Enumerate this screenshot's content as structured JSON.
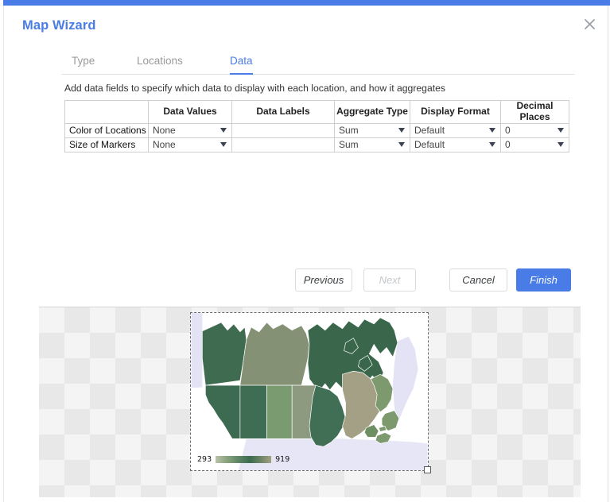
{
  "window": {
    "accent_color": "#4a7ce8",
    "title": "Map Wizard",
    "close_label": "close-icon"
  },
  "tabs": [
    {
      "label": "Type",
      "active": false
    },
    {
      "label": "Locations",
      "active": false
    },
    {
      "label": "Data",
      "active": true
    }
  ],
  "main": {
    "description": "Add data fields to specify which data to display with each location, and how it aggregates",
    "table": {
      "headers": [
        "",
        "Data Values",
        "Data Labels",
        "Aggregate Type",
        "Display Format",
        "Decimal Places"
      ],
      "rows": [
        {
          "label": "Color of Locations",
          "data_values": "None",
          "data_labels": "",
          "aggregate_type": "Sum",
          "display_format": "Default",
          "decimal_places": "0"
        },
        {
          "label": "Size of Markers",
          "data_values": "None",
          "data_labels": "",
          "aggregate_type": "Sum",
          "display_format": "Default",
          "decimal_places": "0"
        }
      ]
    }
  },
  "buttons": {
    "previous": "Previous",
    "next": "Next",
    "cancel": "Cancel",
    "finish": "Finish"
  },
  "preview": {
    "legend_min": "293",
    "legend_max": "919"
  },
  "chart_data": {
    "type": "map",
    "title": "",
    "region": "Canada",
    "color_scale": {
      "min": 293,
      "max": 919,
      "ramp": [
        "#b9c2ab",
        "#8fa882",
        "#5d8464",
        "#3c6b50",
        "#6f8668",
        "#a2a181"
      ]
    },
    "features": [
      {
        "name": "Yukon",
        "color": "#3f6b51"
      },
      {
        "name": "Northwest Territories",
        "color": "#849175"
      },
      {
        "name": "Nunavut",
        "color": "#3a674b"
      },
      {
        "name": "British Columbia",
        "color": "#3d6b51"
      },
      {
        "name": "Alberta",
        "color": "#3f6d53"
      },
      {
        "name": "Saskatchewan",
        "color": "#7a9a70"
      },
      {
        "name": "Manitoba",
        "color": "#8d9a7f"
      },
      {
        "name": "Ontario",
        "color": "#406f56"
      },
      {
        "name": "Quebec",
        "color": "#a3a086"
      },
      {
        "name": "Newfoundland and Labrador",
        "color": "#7d9a6f"
      },
      {
        "name": "New Brunswick",
        "color": "#6e8f62"
      },
      {
        "name": "Nova Scotia",
        "color": "#7d9a6f"
      },
      {
        "name": "Prince Edward Island",
        "color": "#7d9a6f"
      }
    ]
  }
}
